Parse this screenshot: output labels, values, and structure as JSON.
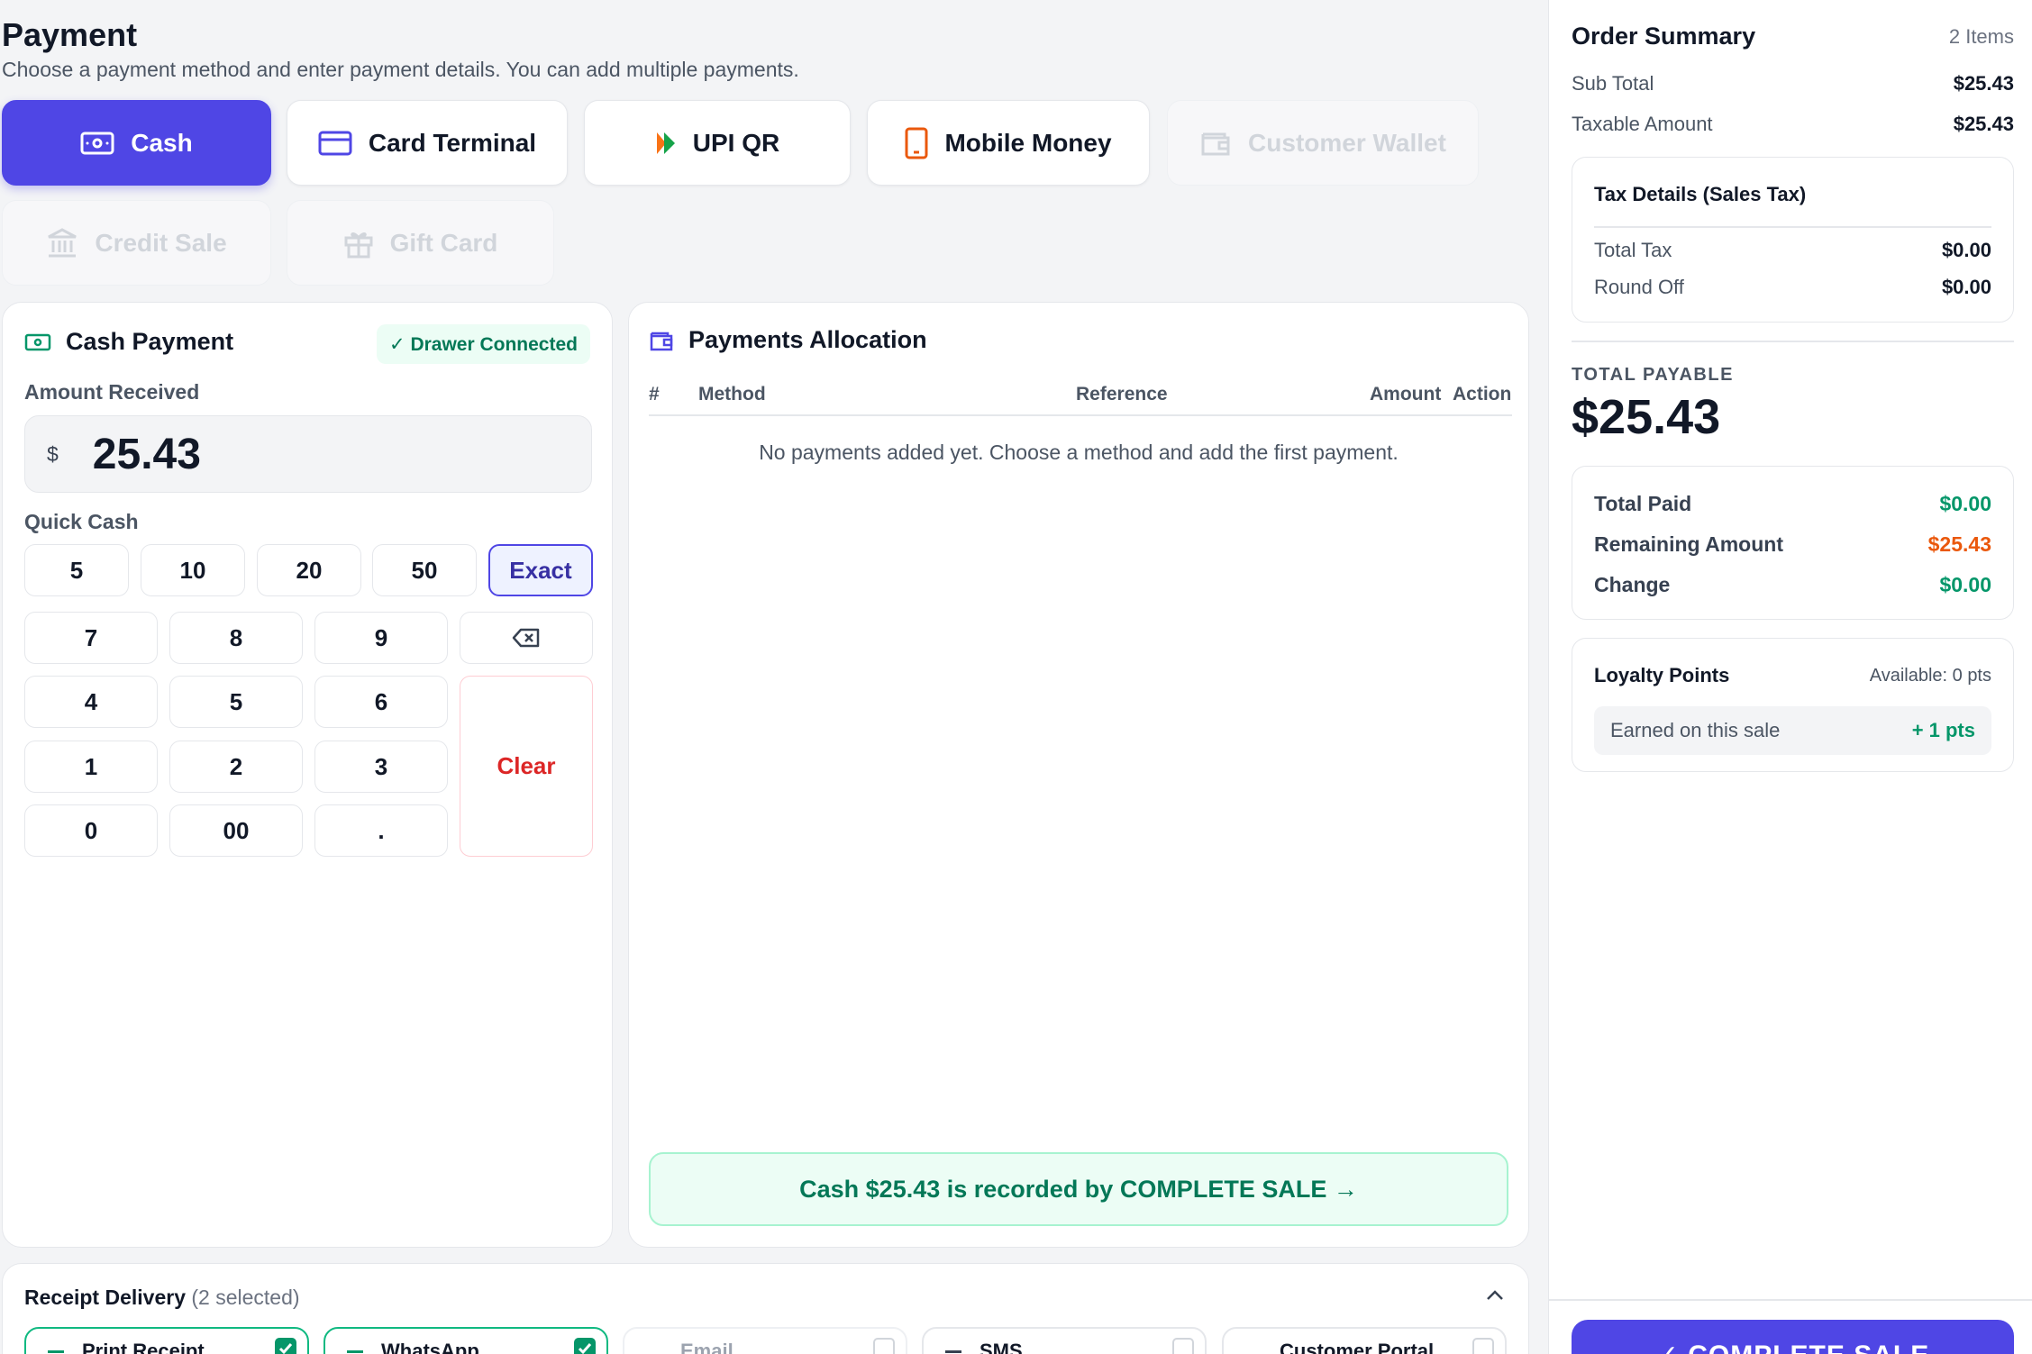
{
  "header": {
    "title": "Payment",
    "subtitle": "Choose a payment method and enter payment details. You can add multiple payments."
  },
  "methods": [
    {
      "label": "Cash",
      "state": "active",
      "icon": "cash-icon"
    },
    {
      "label": "Card Terminal",
      "state": "normal",
      "icon": "card-icon"
    },
    {
      "label": "UPI QR",
      "state": "normal",
      "icon": "upi-icon"
    },
    {
      "label": "Mobile Money",
      "state": "normal",
      "icon": "mobile-icon"
    },
    {
      "label": "Customer Wallet",
      "state": "disabled",
      "icon": "wallet-icon"
    },
    {
      "label": "Credit Sale",
      "state": "disabled",
      "icon": "bank-icon"
    },
    {
      "label": "Gift Card",
      "state": "disabled",
      "icon": "gift-icon"
    }
  ],
  "cash": {
    "title": "Cash Payment",
    "drawer_badge": "✓ Drawer Connected",
    "amount_label": "Amount Received",
    "currency": "$",
    "amount": "25.43",
    "quick_label": "Quick Cash",
    "quick": [
      "5",
      "10",
      "20",
      "50",
      "Exact"
    ],
    "keys": [
      "7",
      "8",
      "9",
      "4",
      "5",
      "6",
      "1",
      "2",
      "3",
      "0",
      "00",
      "."
    ],
    "clear": "Clear"
  },
  "allocation": {
    "title": "Payments Allocation",
    "columns": [
      "#",
      "Method",
      "Reference",
      "Amount",
      "Action"
    ],
    "empty": "No payments added yet. Choose a method and add the first payment.",
    "note": "Cash $25.43 is recorded by COMPLETE SALE →"
  },
  "receipt": {
    "title": "Receipt Delivery",
    "count": "(2 selected)",
    "options": [
      {
        "label": "Print Receipt",
        "checked": true
      },
      {
        "label": "WhatsApp",
        "checked": true
      },
      {
        "label": "Email",
        "checked": false
      },
      {
        "label": "SMS",
        "checked": false
      },
      {
        "label": "Customer Portal",
        "checked": false
      }
    ]
  },
  "summary": {
    "title": "Order Summary",
    "items": "2 Items",
    "sub_total_label": "Sub Total",
    "sub_total": "$25.43",
    "taxable_label": "Taxable Amount",
    "taxable": "$25.43",
    "tax": {
      "title": "Tax Details (Sales Tax)",
      "total_tax_label": "Total Tax",
      "total_tax": "$0.00",
      "round_off_label": "Round Off",
      "round_off": "$0.00"
    },
    "total_payable_label": "TOTAL PAYABLE",
    "total_payable": "$25.43",
    "paid": {
      "total_paid_label": "Total Paid",
      "total_paid": "$0.00",
      "remaining_label": "Remaining Amount",
      "remaining": "$25.43",
      "change_label": "Change",
      "change": "$0.00"
    },
    "loyalty": {
      "title": "Loyalty Points",
      "available": "Available: 0 pts",
      "earned_label": "Earned on this sale",
      "earned": "+ 1 pts"
    },
    "complete_label": "✓ COMPLETE SALE"
  },
  "colors": {
    "accent": "#4f46e5",
    "success": "#059669",
    "warning": "#ea580c",
    "danger": "#dc2626"
  }
}
